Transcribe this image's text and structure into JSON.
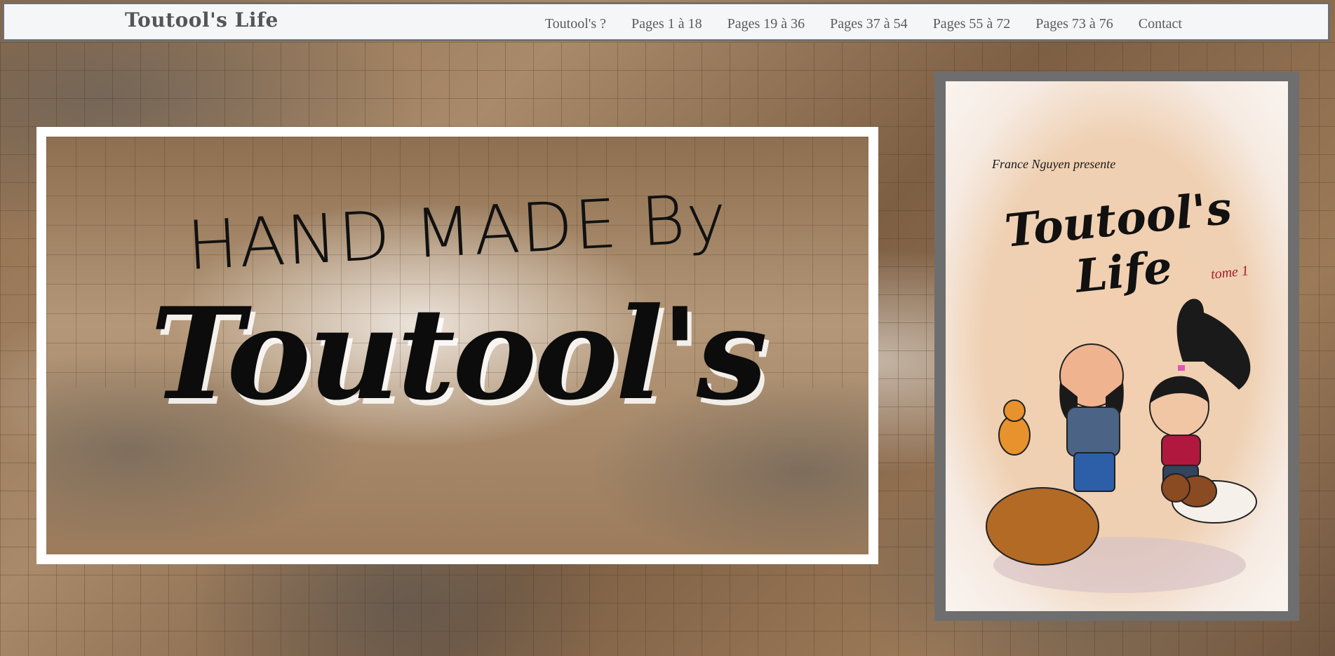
{
  "brand": "Toutool's Life",
  "nav": {
    "items": [
      {
        "label": "Toutool's ?"
      },
      {
        "label": "Pages 1 à 18"
      },
      {
        "label": "Pages 19 à 36"
      },
      {
        "label": "Pages 37 à 54"
      },
      {
        "label": "Pages 55 à 72"
      },
      {
        "label": "Pages 73 à 76"
      },
      {
        "label": "Contact"
      }
    ]
  },
  "hero": {
    "line1": "HAND MADE By",
    "line2": "Toutool's"
  },
  "cover": {
    "presents": "France Nguyen presente",
    "title": "Toutool's Life",
    "tome": "tome 1"
  },
  "colors": {
    "nav_bg": "#f5f6f8",
    "nav_border": "#6f6f6f",
    "nav_text": "#5a5a5a",
    "tome_red": "#a51d2a"
  }
}
